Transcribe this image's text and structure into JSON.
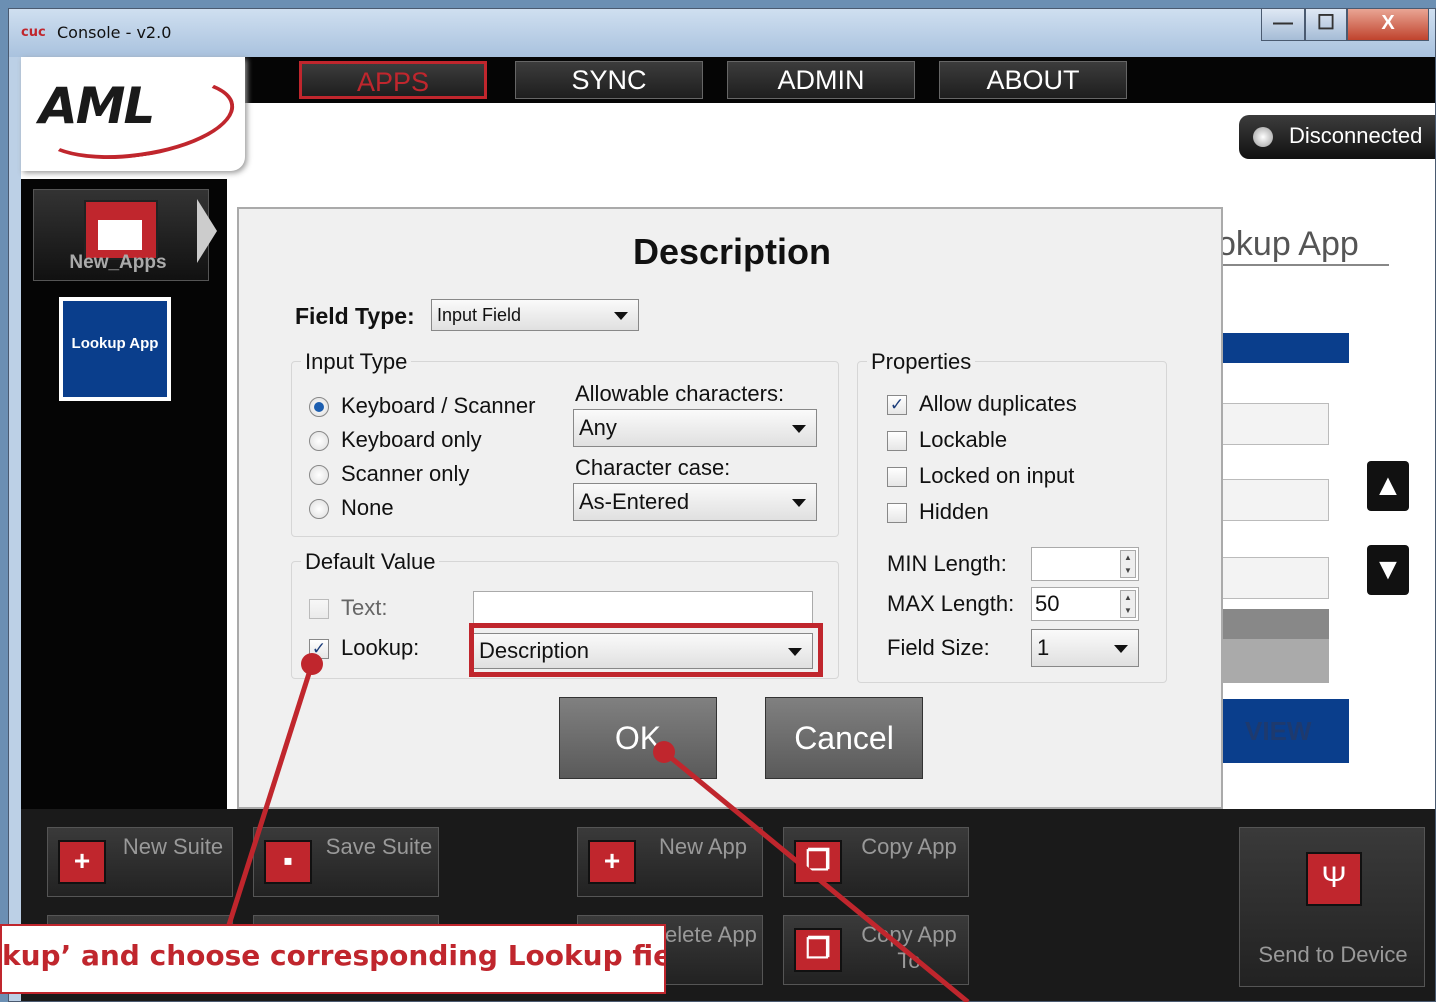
{
  "window": {
    "title": "Console - v2.0",
    "logo": "cuc",
    "min_label": "—",
    "max_label": "☐",
    "close_label": "X"
  },
  "nav": {
    "tabs": [
      {
        "label": "APPS"
      },
      {
        "label": "SYNC"
      },
      {
        "label": "ADMIN"
      },
      {
        "label": "ABOUT"
      }
    ],
    "active": "APPS"
  },
  "brand": {
    "logo_text": "AML"
  },
  "connection": {
    "status": "Disconnected"
  },
  "sidebar": {
    "folder_label": "New_Apps",
    "app_tile_label": "Lookup App"
  },
  "background_page": {
    "title_fragment": "okup App",
    "view_label": "VIEW"
  },
  "dialog": {
    "title": "Description",
    "field_type": {
      "label": "Field Type:",
      "value": "Input Field"
    },
    "input_type": {
      "title": "Input Type",
      "options": [
        {
          "label": "Keyboard / Scanner",
          "selected": true
        },
        {
          "label": "Keyboard only",
          "selected": false
        },
        {
          "label": "Scanner only",
          "selected": false
        },
        {
          "label": "None",
          "selected": false
        }
      ],
      "allowable_label": "Allowable characters:",
      "allowable_value": "Any",
      "case_label": "Character case:",
      "case_value": "As-Entered"
    },
    "default_value": {
      "title": "Default Value",
      "text_label": "Text:",
      "text_checked": false,
      "text_value": "",
      "lookup_label": "Lookup:",
      "lookup_checked": true,
      "lookup_value": "Description"
    },
    "properties": {
      "title": "Properties",
      "checks": [
        {
          "label": "Allow duplicates",
          "checked": true
        },
        {
          "label": "Lockable",
          "checked": false
        },
        {
          "label": "Locked on input",
          "checked": false
        },
        {
          "label": "Hidden",
          "checked": false
        }
      ],
      "min_label": "MIN Length:",
      "min_value": "",
      "max_label": "MAX Length:",
      "max_value": "50",
      "size_label": "Field Size:",
      "size_value": "1"
    },
    "ok_label": "OK",
    "cancel_label": "Cancel"
  },
  "toolbar": {
    "new_suite": "New Suite",
    "save_suite": "Save Suite",
    "new_app": "New App",
    "copy_app": "Copy App",
    "delete_app": "Delete App",
    "copy_app_to": "Copy App To",
    "send_to_device": "Send to Device"
  },
  "annotation": {
    "callout_text": "kup’ and choose corresponding Lookup field"
  },
  "colors": {
    "accent": "#c0262d",
    "brand_blue": "#0a3e8c",
    "toolbar_bg": "#1a1a1a"
  }
}
